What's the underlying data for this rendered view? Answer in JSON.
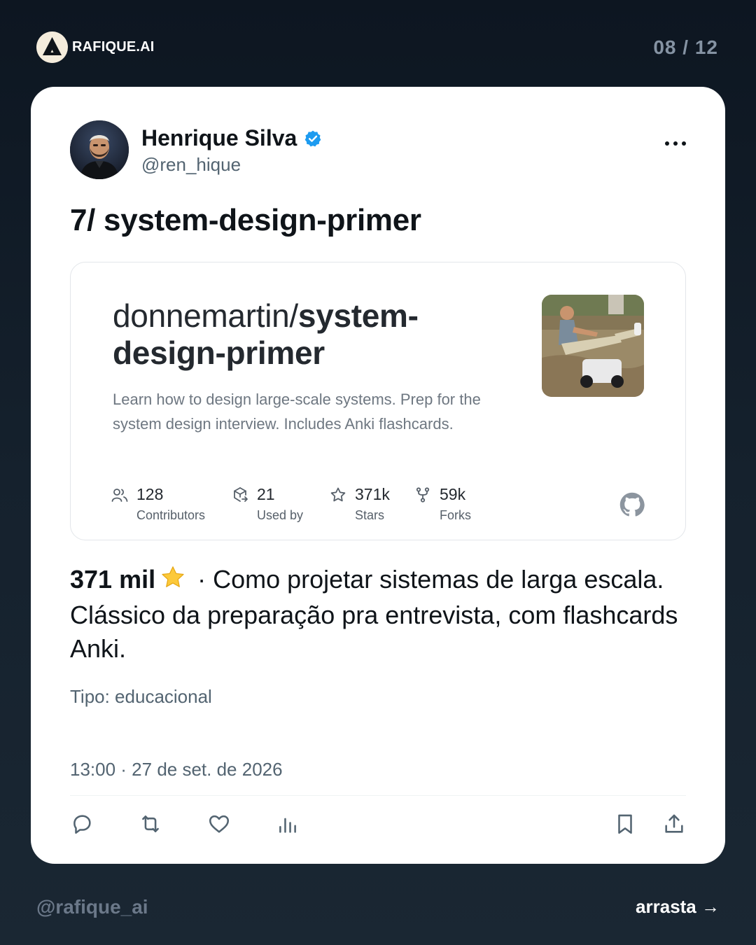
{
  "brand": {
    "name": "RAFIQUE.AI",
    "logo_icon": "triangle-logo-icon"
  },
  "page_counter": "08 / 12",
  "tweet": {
    "author": {
      "name": "Henrique Silva",
      "handle": "@ren_hique",
      "verified": true,
      "verified_color": "#1d9bf0"
    },
    "title": "7/ system-design-primer",
    "repo": {
      "owner": "donnemartin/",
      "name": "system-design-primer",
      "description": "Learn how to design large-scale systems. Prep for the system design interview. Includes Anki flashcards.",
      "stats": [
        {
          "icon": "contributors-icon",
          "value": "128",
          "label": "Contributors"
        },
        {
          "icon": "used-by-icon",
          "value": "21",
          "label": "Used by"
        },
        {
          "icon": "star-outline-icon",
          "value": "371k",
          "label": "Stars"
        },
        {
          "icon": "fork-icon",
          "value": "59k",
          "label": "Forks"
        }
      ]
    },
    "body": {
      "stars": "371 mil",
      "text": " · Como projetar sistemas de larga escala. Clássico da preparação pra entrevista, com flashcards Anki."
    },
    "type_label": "Tipo: educacional",
    "timestamp": "13:00 · 27 de set. de 2026",
    "actions": [
      "reply-icon",
      "retweet-icon",
      "like-icon",
      "views-icon",
      "bookmark-icon",
      "share-icon"
    ]
  },
  "footer": {
    "handle": "@rafique_ai",
    "swipe": "arrasta →"
  },
  "colors": {
    "background": "#101a25",
    "card": "#ffffff",
    "text": "#0f1419",
    "muted": "#536471",
    "brand_logo_bg": "#f4ecdc"
  }
}
